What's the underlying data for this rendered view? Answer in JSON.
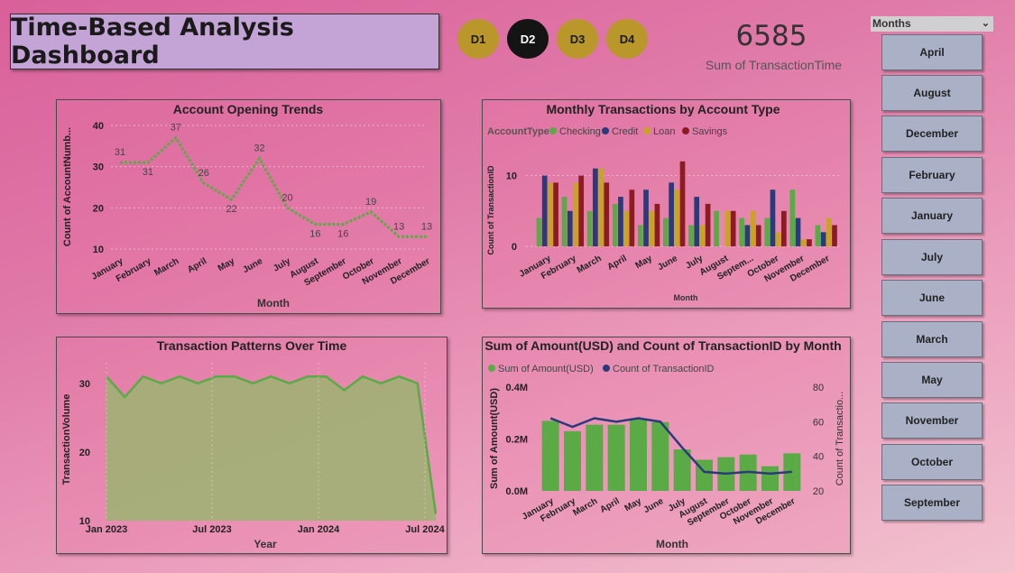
{
  "title": "Time-Based Analysis Dashboard",
  "nav_buttons": [
    {
      "label": "D1",
      "active": false
    },
    {
      "label": "D2",
      "active": true
    },
    {
      "label": "D3",
      "active": false
    },
    {
      "label": "D4",
      "active": false
    }
  ],
  "kpi": {
    "value": "6585",
    "label": "Sum of TransactionTime"
  },
  "slicer": {
    "header": "Months",
    "items": [
      "April",
      "August",
      "December",
      "February",
      "January",
      "July",
      "June",
      "March",
      "May",
      "November",
      "October",
      "September"
    ]
  },
  "colors": {
    "green": "#5aab45",
    "navy": "#2b3a78",
    "gold": "#c9a227",
    "maroon": "#8c1c24",
    "area_fill": "#a0b074"
  },
  "chart_data": [
    {
      "type": "line",
      "title": "Account Opening Trends",
      "xlabel": "Month",
      "ylabel": "Count of AccountNumb...",
      "categories": [
        "January",
        "February",
        "March",
        "April",
        "May",
        "June",
        "July",
        "August",
        "September",
        "October",
        "November",
        "December"
      ],
      "values": [
        31,
        31,
        37,
        26,
        22,
        32,
        20,
        16,
        16,
        19,
        13,
        13
      ],
      "yticks": [
        10,
        20,
        30,
        40
      ],
      "ylim": [
        10,
        40
      ],
      "grid": true
    },
    {
      "type": "bar",
      "title": "Monthly Transactions by Account Type",
      "legend_title": "AccountType",
      "xlabel": "Month",
      "ylabel": "Count of TransactionID",
      "categories": [
        "January",
        "February",
        "March",
        "April",
        "May",
        "June",
        "July",
        "August",
        "Septem...",
        "October",
        "November",
        "December"
      ],
      "series": [
        {
          "name": "Checking",
          "values": [
            4,
            7,
            5,
            6,
            3,
            4,
            3,
            5,
            4,
            4,
            8,
            3
          ]
        },
        {
          "name": "Credit",
          "values": [
            10,
            5,
            11,
            7,
            8,
            9,
            7,
            0,
            3,
            8,
            4,
            2
          ]
        },
        {
          "name": "Loan",
          "values": [
            9,
            9,
            11,
            5,
            5,
            8,
            3,
            5,
            5,
            2,
            1,
            4
          ]
        },
        {
          "name": "Savings",
          "values": [
            9,
            10,
            9,
            8,
            6,
            12,
            6,
            5,
            3,
            5,
            1,
            3
          ]
        }
      ],
      "yticks": [
        0,
        10
      ],
      "ylim": [
        0,
        13
      ],
      "legend_position": "top-left"
    },
    {
      "type": "area",
      "title": "Transaction Patterns Over Time",
      "xlabel": "Year",
      "ylabel": "TransactionVolume",
      "xticks": [
        "Jan 2023",
        "Jul 2023",
        "Jan 2024",
        "Jul 2024"
      ],
      "values": [
        31,
        28,
        31,
        30,
        31,
        30,
        31,
        31,
        30,
        31,
        30,
        31,
        31,
        29,
        31,
        30,
        31,
        30,
        11
      ],
      "yticks": [
        10,
        20,
        30
      ],
      "ylim": [
        10,
        33
      ]
    },
    {
      "type": "bar",
      "title": "Sum of Amount(USD) and Count of TransactionID by Month",
      "xlabel": "Month",
      "ylabel": "Sum of Amount(USD)",
      "ylabel_right": "Count of Transactio...",
      "categories": [
        "January",
        "February",
        "March",
        "April",
        "May",
        "June",
        "July",
        "August",
        "September",
        "October",
        "November",
        "December"
      ],
      "series": [
        {
          "name": "Sum of Amount(USD)",
          "type": "bar",
          "values": [
            0.27,
            0.23,
            0.255,
            0.255,
            0.275,
            0.265,
            0.16,
            0.12,
            0.13,
            0.14,
            0.095,
            0.145
          ]
        },
        {
          "name": "Count of TransactionID",
          "type": "line",
          "values": [
            62,
            57,
            62,
            60,
            62,
            60,
            45,
            31,
            30,
            31,
            30,
            31
          ]
        }
      ],
      "yticks": [
        "0.0M",
        "0.2M",
        "0.4M"
      ],
      "ylim": [
        0,
        0.4
      ],
      "yticks_right": [
        20,
        40,
        60,
        80
      ],
      "ylim_right": [
        20,
        80
      ],
      "legend_position": "top-left"
    }
  ]
}
